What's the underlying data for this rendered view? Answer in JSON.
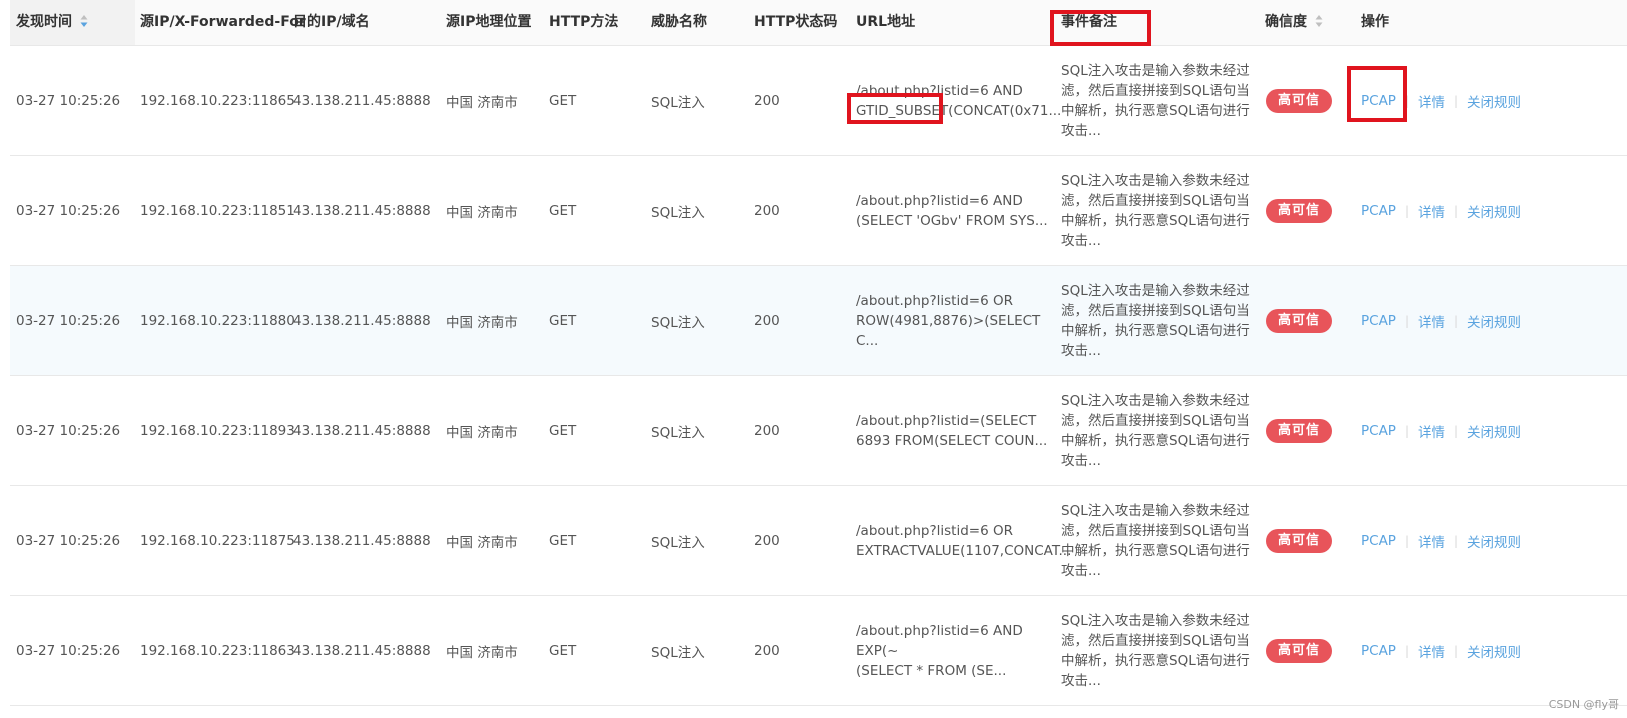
{
  "headers": {
    "time": "发现时间",
    "src_ip": "源IP/X-Forwarded-For",
    "dst_ip": "目的IP/域名",
    "geo": "源IP地理位置",
    "method": "HTTP方法",
    "threat": "威胁名称",
    "status": "HTTP状态码",
    "url": "URL地址",
    "note": "事件备注",
    "confidence": "确信度",
    "action": "操作"
  },
  "rows": [
    {
      "time": "03-27 10:25:26",
      "src_ip": "192.168.10.223:11865",
      "dst_ip": "43.138.211.45:8888",
      "geo": "中国 济南市",
      "method": "GET",
      "threat": "SQL注入",
      "status": "200",
      "url_line1": "/about.php?listid=6 AND",
      "url_line2": "GTID_SUBSET(CONCAT(0x71...",
      "note": [
        "SQL注入攻击是输入参数未经过",
        "滤，然后直接拼接到SQL语句当",
        "中解析，执行恶意SQL语句进行",
        "攻击..."
      ],
      "confidence": "高可信",
      "pcap": "PCAP",
      "detail": "详情",
      "close_rule": "关闭规则"
    },
    {
      "time": "03-27 10:25:26",
      "src_ip": "192.168.10.223:11851",
      "dst_ip": "43.138.211.45:8888",
      "geo": "中国 济南市",
      "method": "GET",
      "threat": "SQL注入",
      "status": "200",
      "url_line1": "/about.php?listid=6 AND",
      "url_line2": "(SELECT 'OGbv' FROM SYS...",
      "note": [
        "SQL注入攻击是输入参数未经过",
        "滤，然后直接拼接到SQL语句当",
        "中解析，执行恶意SQL语句进行",
        "攻击..."
      ],
      "confidence": "高可信",
      "pcap": "PCAP",
      "detail": "详情",
      "close_rule": "关闭规则"
    },
    {
      "time": "03-27 10:25:26",
      "src_ip": "192.168.10.223:11880",
      "dst_ip": "43.138.211.45:8888",
      "geo": "中国 济南市",
      "method": "GET",
      "threat": "SQL注入",
      "status": "200",
      "url_line1": "/about.php?listid=6 OR",
      "url_line2": "ROW(4981,8876)>(SELECT C...",
      "note": [
        "SQL注入攻击是输入参数未经过",
        "滤，然后直接拼接到SQL语句当",
        "中解析，执行恶意SQL语句进行",
        "攻击..."
      ],
      "confidence": "高可信",
      "pcap": "PCAP",
      "detail": "详情",
      "close_rule": "关闭规则"
    },
    {
      "time": "03-27 10:25:26",
      "src_ip": "192.168.10.223:11893",
      "dst_ip": "43.138.211.45:8888",
      "geo": "中国 济南市",
      "method": "GET",
      "threat": "SQL注入",
      "status": "200",
      "url_line1": "/about.php?listid=(SELECT",
      "url_line2": "6893 FROM(SELECT COUN...",
      "note": [
        "SQL注入攻击是输入参数未经过",
        "滤，然后直接拼接到SQL语句当",
        "中解析，执行恶意SQL语句进行",
        "攻击..."
      ],
      "confidence": "高可信",
      "pcap": "PCAP",
      "detail": "详情",
      "close_rule": "关闭规则"
    },
    {
      "time": "03-27 10:25:26",
      "src_ip": "192.168.10.223:11875",
      "dst_ip": "43.138.211.45:8888",
      "geo": "中国 济南市",
      "method": "GET",
      "threat": "SQL注入",
      "status": "200",
      "url_line1": "/about.php?listid=6 OR",
      "url_line2": "EXTRACTVALUE(1107,CONCAT...",
      "note": [
        "SQL注入攻击是输入参数未经过",
        "滤，然后直接拼接到SQL语句当",
        "中解析，执行恶意SQL语句进行",
        "攻击..."
      ],
      "confidence": "高可信",
      "pcap": "PCAP",
      "detail": "详情",
      "close_rule": "关闭规则"
    },
    {
      "time": "03-27 10:25:26",
      "src_ip": "192.168.10.223:11863",
      "dst_ip": "43.138.211.45:8888",
      "geo": "中国 济南市",
      "method": "GET",
      "threat": "SQL注入",
      "status": "200",
      "url_line1": "/about.php?listid=6 AND EXP(~",
      "url_line2": "(SELECT * FROM (SE...",
      "note": [
        "SQL注入攻击是输入参数未经过",
        "滤，然后直接拼接到SQL语句当",
        "中解析，执行恶意SQL语句进行",
        "攻击..."
      ],
      "confidence": "高可信",
      "pcap": "PCAP",
      "detail": "详情",
      "close_rule": "关闭规则"
    }
  ],
  "watermark": "CSDN @fly哥",
  "colors": {
    "badge": "#e8545a",
    "link": "#5aa3df",
    "highlight": "#e0141e",
    "row_alt": "#f5fafd"
  }
}
